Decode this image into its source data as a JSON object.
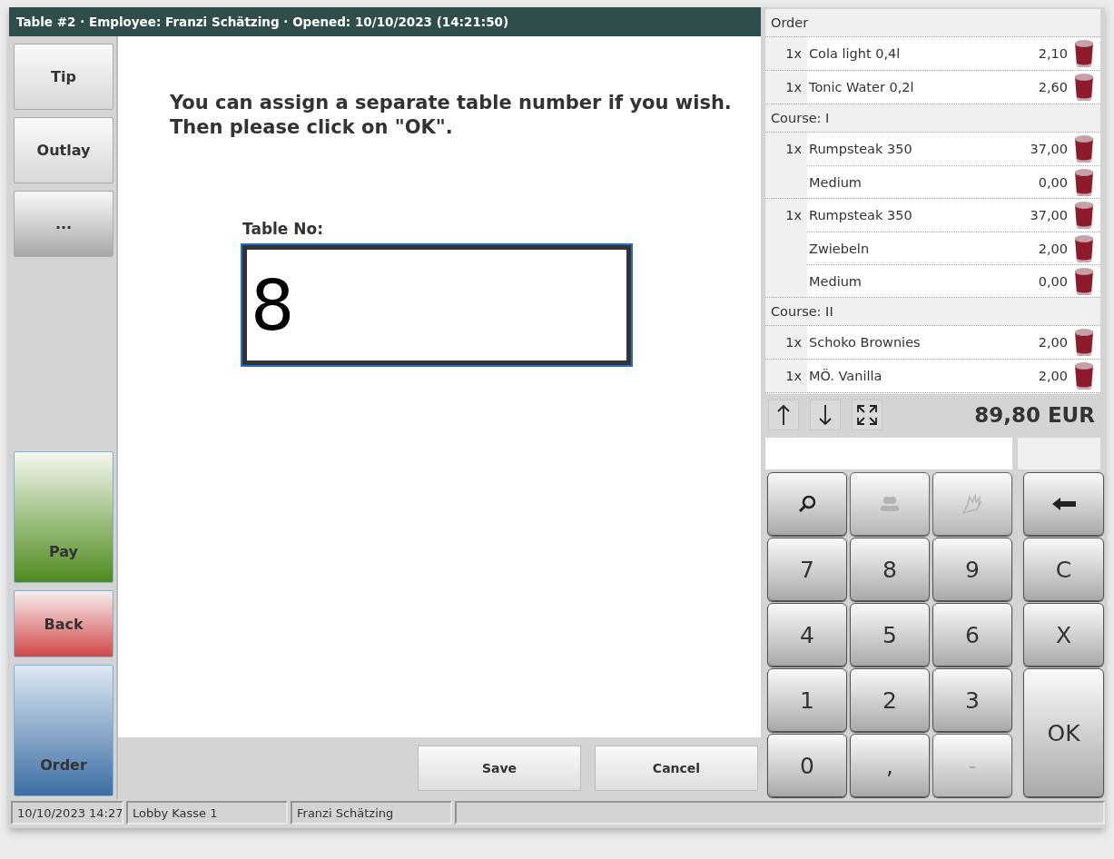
{
  "window": {
    "title": "Table #2 · Employee: Franzi Schätzing · Opened: 10/10/2023 (14:21:50)"
  },
  "sidebar": {
    "top": [
      {
        "label": "Tip",
        "kind": "standard"
      },
      {
        "label": "Outlay",
        "kind": "standard"
      },
      {
        "label": "...",
        "kind": "more"
      }
    ],
    "bottom": [
      {
        "label": "Pay",
        "kind": "pay"
      },
      {
        "label": "Back",
        "kind": "back"
      },
      {
        "label": "Order",
        "kind": "order"
      }
    ]
  },
  "dialog": {
    "message": "You can assign a separate table number if you wish.\nThen please click on \"OK\".",
    "field_label": "Table No:",
    "field_value": "8",
    "buttons": [
      "Save",
      "Cancel"
    ]
  },
  "order_list": [
    {
      "title": "Order",
      "items": [
        {
          "qty": "1x",
          "name": "Cola light 0,4l",
          "price": "2,10"
        },
        {
          "qty": "1x",
          "name": "Tonic Water 0,2l",
          "price": "2,60"
        }
      ]
    },
    {
      "title": "Course: I",
      "items": [
        {
          "qty": "1x",
          "name": "Rumpsteak 350",
          "price": "37,00",
          "children": [
            {
              "name": "Medium",
              "price": "0,00"
            }
          ]
        },
        {
          "qty": "1x",
          "name": "Rumpsteak 350",
          "price": "37,00",
          "children": [
            {
              "name": "Zwiebeln",
              "price": "2,00"
            },
            {
              "name": "Medium",
              "price": "0,00"
            }
          ]
        }
      ]
    },
    {
      "title": "Course: II",
      "items": [
        {
          "qty": "1x",
          "name": "Schoko Brownies",
          "price": "2,00"
        },
        {
          "qty": "1x",
          "name": "MÖ. Vanilla",
          "price": "2,00"
        }
      ]
    }
  ],
  "toolbar": {
    "buttons": [
      {
        "kind": "up"
      },
      {
        "kind": "down"
      },
      {
        "kind": "expand"
      }
    ],
    "total": "89,80 EUR"
  },
  "keypad": [
    {
      "kind": "search",
      "disabled": false
    },
    {
      "kind": "people",
      "disabled": true
    },
    {
      "kind": "hand",
      "disabled": true
    },
    {
      "kind": "backspace",
      "disabled": false
    },
    {
      "kind": "text",
      "label": "7",
      "disabled": false
    },
    {
      "kind": "text",
      "label": "8",
      "disabled": false
    },
    {
      "kind": "text",
      "label": "9",
      "disabled": false
    },
    {
      "kind": "text",
      "label": "C",
      "disabled": false
    },
    {
      "kind": "text",
      "label": "4",
      "disabled": false
    },
    {
      "kind": "text",
      "label": "5",
      "disabled": false
    },
    {
      "kind": "text",
      "label": "6",
      "disabled": false
    },
    {
      "kind": "text",
      "label": "X",
      "disabled": false
    },
    {
      "kind": "text",
      "label": "1",
      "disabled": false
    },
    {
      "kind": "text",
      "label": "2",
      "disabled": false
    },
    {
      "kind": "text",
      "label": "3",
      "disabled": false
    },
    {
      "kind": "enter",
      "label": "OK",
      "disabled": false
    },
    {
      "kind": "text",
      "label": "0",
      "disabled": false
    },
    {
      "kind": "text",
      "label": ",",
      "disabled": false
    },
    {
      "kind": "text",
      "label": "-",
      "disabled": true
    }
  ],
  "status_bar": [
    "10/10/2023 14:27",
    "Lobby Kasse 1",
    "Franzi Schätzing"
  ]
}
